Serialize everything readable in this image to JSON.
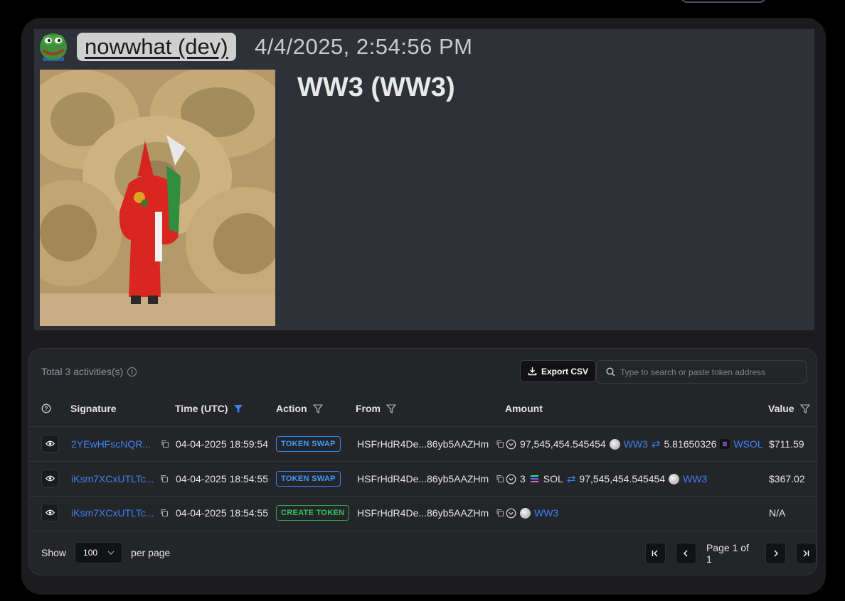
{
  "post": {
    "author": "nowwhat (dev)",
    "timestamp": "4/4/2025, 2:54:56 PM",
    "token_title": "WW3 (WW3)"
  },
  "activity": {
    "total_label": "Total 3 activities(s)",
    "export_label": "Export CSV",
    "search_placeholder": "Type to search or paste token address",
    "columns": {
      "signature": "Signature",
      "time": "Time (UTC)",
      "action": "Action",
      "from": "From",
      "amount": "Amount",
      "value": "Value"
    },
    "rows": [
      {
        "signature": "2YEwHFscNQR...",
        "time": "04-04-2025 18:59:54",
        "action": "TOKEN SWAP",
        "from": "HSFrHdR4De...86yb5AAZHm",
        "amount_in": "97,545,454.545454",
        "token_in": "WW3",
        "amount_out": "5.81650326",
        "token_out": "WSOL",
        "value": "$711.59"
      },
      {
        "signature": "iKsm7XCxUTLTc...",
        "time": "04-04-2025 18:54:55",
        "action": "TOKEN SWAP",
        "from": "HSFrHdR4De...86yb5AAZHm",
        "amount_in": "3",
        "token_in": "SOL",
        "amount_out": "97,545,454.545454",
        "token_out": "WW3",
        "value": "$367.02"
      },
      {
        "signature": "iKsm7XCxUTLTc...",
        "time": "04-04-2025 18:54:55",
        "action": "CREATE TOKEN",
        "from": "HSFrHdR4De...86yb5AAZHm",
        "token": "WW3",
        "value": "N/A"
      }
    ],
    "show_label": "Show",
    "per_page_value": "100",
    "per_page_label": "per page",
    "page_label": "Page 1 of 1"
  },
  "colors": {
    "link": "#3b82f6",
    "create_badge": "#34c759",
    "post_bg": "#2e3138"
  }
}
